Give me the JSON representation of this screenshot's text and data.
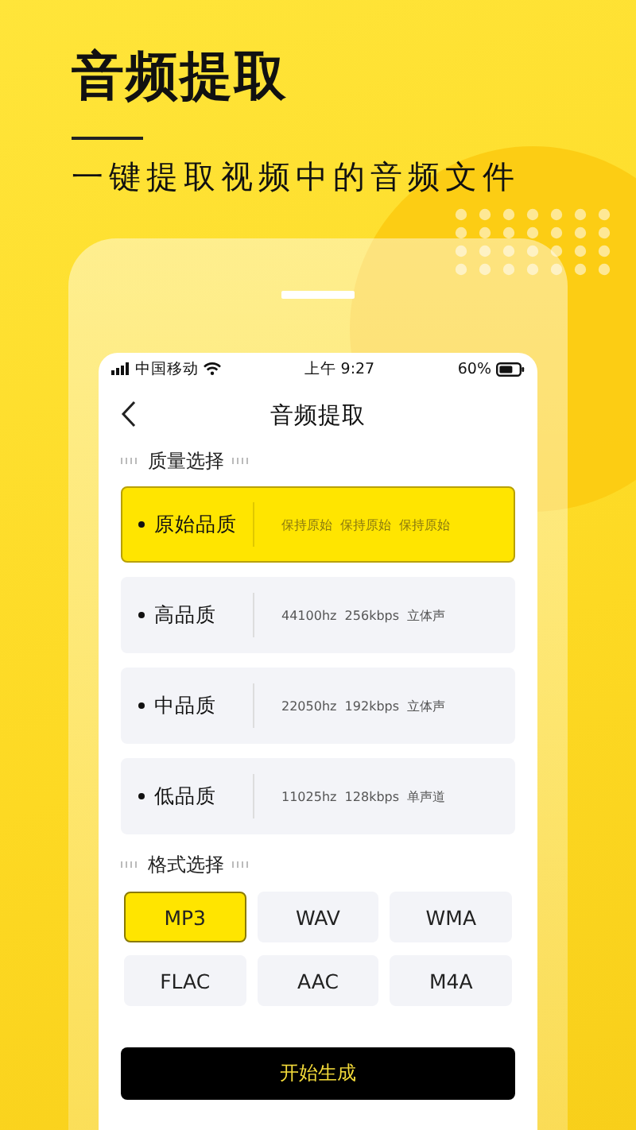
{
  "headline": "音频提取",
  "subtitle": "一键提取视频中的音频文件",
  "status_bar": {
    "carrier": "中国移动",
    "time": "上午 9:27",
    "battery": "60%"
  },
  "nav": {
    "title": "音频提取"
  },
  "quality_section": {
    "title": "质量选择",
    "options": [
      {
        "label": "原始品质",
        "spec": "保持原始  保持原始  保持原始",
        "selected": true
      },
      {
        "label": "高品质",
        "spec": "44100hz  256kbps  立体声",
        "selected": false
      },
      {
        "label": "中品质",
        "spec": "22050hz  192kbps  立体声",
        "selected": false
      },
      {
        "label": "低品质",
        "spec": "11025hz  128kbps  单声道",
        "selected": false
      }
    ]
  },
  "format_section": {
    "title": "格式选择",
    "options": [
      {
        "label": "MP3",
        "selected": true
      },
      {
        "label": "WAV",
        "selected": false
      },
      {
        "label": "WMA",
        "selected": false
      },
      {
        "label": "FLAC",
        "selected": false
      },
      {
        "label": "AAC",
        "selected": false
      },
      {
        "label": "M4A",
        "selected": false
      }
    ]
  },
  "start_button": {
    "label": "开始生成"
  }
}
